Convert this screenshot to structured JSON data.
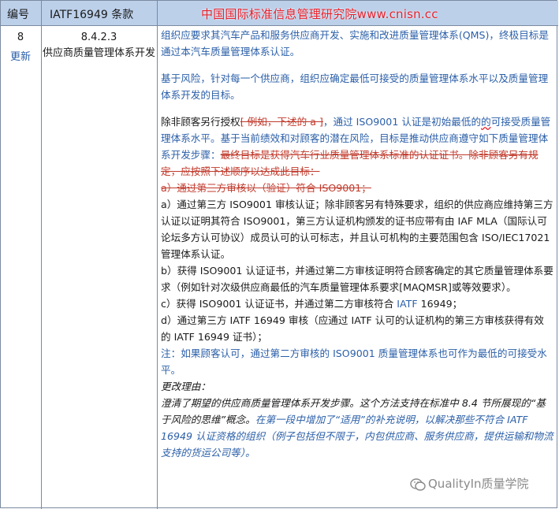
{
  "header": {
    "col_number": "编号",
    "col_clause": "IATF16949 条款",
    "watermark": "中国国际标准信息管理研究院www.cnisn.cc"
  },
  "row": {
    "number": "8",
    "status": "更新",
    "clause_number": "8.4.2.3",
    "clause_title": "供应商质量管理体系开发"
  },
  "content": {
    "p1": "组织应要求其汽车产品和服务供应商开发、实施和改进质量管理体系(QMS)，终极目标是通过本汽车质量管理体系认证。",
    "p2": "基于风险，针对每一个供应商，组织应确定最低可接受的质量管理体系水平以及质量管理体系开发的目标。",
    "p3_a": "除非顾客另行授权",
    "p3_strike": "[ 例如，下述的 a ]",
    "p3_b": "，通过 ISO9001 认证是初始最低的",
    "p3_wavy": "的",
    "p3_c": "可接受质量管理体系水平。基于当前绩效和对顾客的潜在风险，目标是推动供应商遵守如下质量管理体系开发步骤：",
    "p3_strike2": "最终目标是获得汽车行业质量管理体系标准的认证证书。除非顾客另有规定，应按照下述顺序以达成此目标：",
    "p4_strike": "a）通过第三方审核以（验证）符合 ISO9001；",
    "p5": "a）通过第三方 ISO9001 审核认证；除非顾客另有特殊要求，组织的供应商应维持第三方认证以证明其符合 ISO9001，第三方认证机构颁发的证书应带有由 IAF MLA（国际认可论坛多方认可协议）成员认可的认可标志，并且认可机构的主要范围包含 ISO/IEC17021 管理体系认证。",
    "p6": "b）获得 ISO9001 认证证书，并通过第二方审核证明符合顾客确定的其它质量管理体系要求（例如针对次级供应商最低的汽车质量管理体系要求[MAQMSR]或等效要求）。",
    "p7_a": "c）获得 ISO9001 认证证书，并通过第二方审核符合 ",
    "p7_b": "IATF",
    "p7_c": " 16949；",
    "p8": "d）通过第三方 IATF 16949 审核（应通过 IATF 认可的认证机构的第三方审核获得有效的 IATF 16949 证书）；",
    "p9": "注：如果顾客认可，通过第二方审核的 ISO9001 质量管理体系也可作为最低的可接受水平。",
    "reason_label": "更改理由：",
    "reason_a": "澄清了期望的供应商质量管理体系开发步骤。这个方法支持在标准中 8.4 节所展现的“基于风险的思维”概念。",
    "reason_b": "在第一段中增加了“适用”的补充说明，以解决那些不符合 IATF 16949 认证资格的组织（例子包括但不限于，内包供应商、服务供应商，提供运输和物流支持的货运公司等）。"
  },
  "wechat_watermark": "QualityIn质量学院",
  "colors": {
    "header_bg": "#bcd0ea",
    "blue_text": "#2b5fa8",
    "watermark_red": "#e8202a"
  }
}
